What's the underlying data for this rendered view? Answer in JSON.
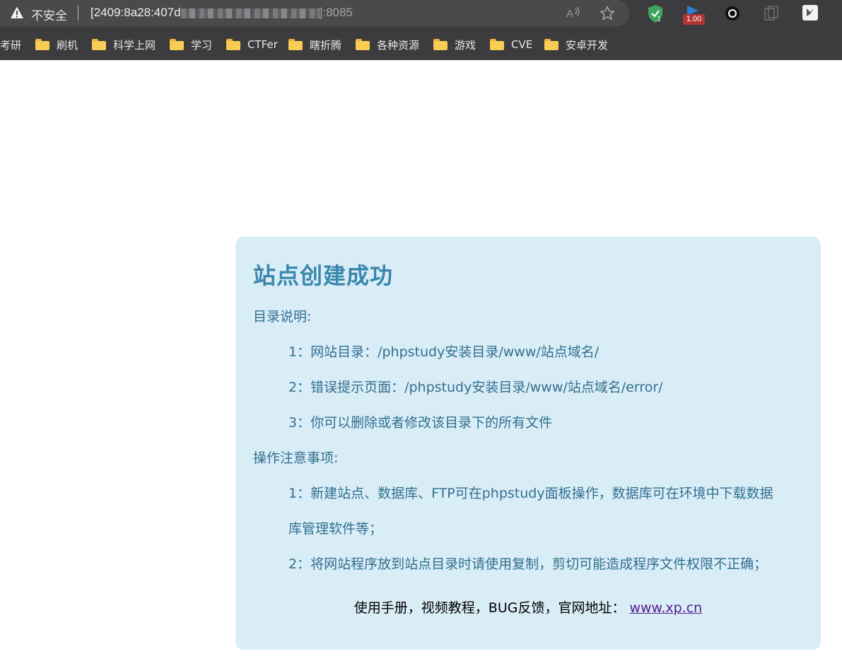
{
  "browser": {
    "security_label": "不安全",
    "url_prefix": "[2409:8a28:407d",
    "url_suffix": "]:8085",
    "bookmarks": [
      {
        "label": "考研",
        "folder": false
      },
      {
        "label": "刷机",
        "folder": true
      },
      {
        "label": "科学上网",
        "folder": true
      },
      {
        "label": "学习",
        "folder": true
      },
      {
        "label": "CTFer",
        "folder": true
      },
      {
        "label": "瞎折腾",
        "folder": true
      },
      {
        "label": "各种资源",
        "folder": true
      },
      {
        "label": "游戏",
        "folder": true
      },
      {
        "label": "CVE",
        "folder": true
      },
      {
        "label": "安卓开发",
        "folder": true
      }
    ],
    "extensions": {
      "shield_badge": "1",
      "speed_badge": "1.00"
    },
    "colors": {
      "chrome_bg": "#3c3c3e",
      "folder": "#f8cd54",
      "badge_red": "#b03434"
    }
  },
  "page": {
    "title": "站点创建成功",
    "dir_heading": "目录说明:",
    "dir_items": [
      "1：网站目录：/phpstudy安装目录/www/站点域名/",
      "2：错误提示页面：/phpstudy安装目录/www/站点域名/error/",
      "3：你可以删除或者修改该目录下的所有文件"
    ],
    "notes_heading": "操作注意事项:",
    "notes_items": [
      "1：新建站点、数据库、FTP可在phpstudy面板操作，数据库可在环境中下载数据",
      "库管理软件等；",
      "2：将网站程序放到站点目录时请使用复制，剪切可能造成程序文件权限不正确；"
    ],
    "footer_text": "使用手册，视频教程，BUG反馈，官网地址：",
    "footer_link": "www.xp.cn",
    "colors": {
      "card_bg": "#d9edf7",
      "title": "#3a87ad",
      "text": "#31708f",
      "link": "#551a8b"
    }
  }
}
